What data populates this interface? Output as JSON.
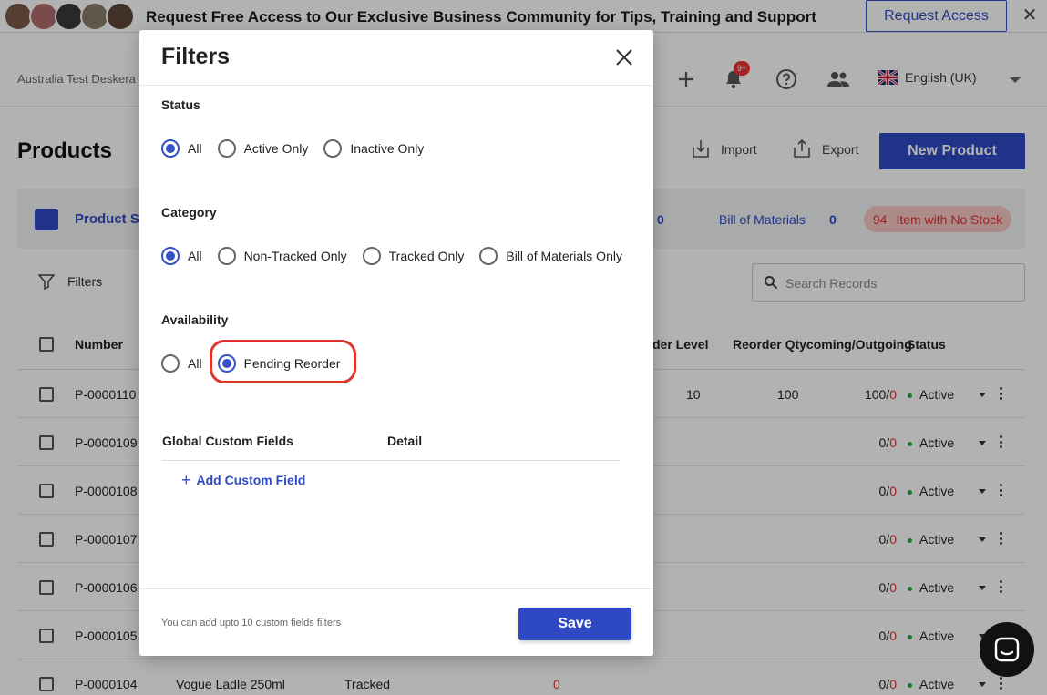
{
  "promo": {
    "text_prefix": "Request ",
    "text_bold": "Free Access",
    "text_suffix": " to Our Exclusive Business Community for Tips, Training and Support",
    "request_label": "Request Access",
    "close_glyph": "✕"
  },
  "header": {
    "company": "Australia Test Deskera",
    "notification_badge": "9+",
    "language": "English (UK)"
  },
  "page": {
    "title": "Products",
    "import_label": "Import",
    "export_label": "Export",
    "new_product_label": "New Product"
  },
  "summary": {
    "title": "Product Su",
    "first_count": "0",
    "bom_label": "Bill of Materials",
    "bom_count": "0",
    "nostock_count": "94",
    "nostock_label": "Item with No Stock"
  },
  "toolbar": {
    "filters_label": "Filters",
    "search_placeholder": "Search Records"
  },
  "table": {
    "headers": {
      "number": "Number",
      "reorder_level": "der Level",
      "reorder_qty_inout": "Reorder Qtycoming/Outgoing",
      "status": "Status"
    },
    "rows": [
      {
        "number": "P-0000110",
        "name": "",
        "type": "",
        "stock": "",
        "reorder_level": "10",
        "reorder_qty": "100",
        "io_main": "100/",
        "io_red": "0",
        "status": "Active"
      },
      {
        "number": "P-0000109",
        "name": "",
        "type": "",
        "stock": "",
        "reorder_level": "",
        "reorder_qty": "",
        "io_main": "0/",
        "io_red": "0",
        "status": "Active"
      },
      {
        "number": "P-0000108",
        "name": "",
        "type": "",
        "stock": "",
        "reorder_level": "",
        "reorder_qty": "",
        "io_main": "0/",
        "io_red": "0",
        "status": "Active"
      },
      {
        "number": "P-0000107",
        "name": "",
        "type": "",
        "stock": "",
        "reorder_level": "",
        "reorder_qty": "",
        "io_main": "0/",
        "io_red": "0",
        "status": "Active"
      },
      {
        "number": "P-0000106",
        "name": "",
        "type": "",
        "stock": "",
        "reorder_level": "",
        "reorder_qty": "",
        "io_main": "0/",
        "io_red": "0",
        "status": "Active"
      },
      {
        "number": "P-0000105",
        "name": "",
        "type": "",
        "stock": "",
        "reorder_level": "",
        "reorder_qty": "",
        "io_main": "0/",
        "io_red": "0",
        "status": "Active"
      },
      {
        "number": "P-0000104",
        "name": "Vogue Ladle 250ml",
        "type": "Tracked",
        "stock": "0",
        "reorder_level": "",
        "reorder_qty": "",
        "io_main": "0/",
        "io_red": "0",
        "status": "Active"
      }
    ]
  },
  "modal": {
    "title": "Filters",
    "status": {
      "label": "Status",
      "options": [
        "All",
        "Active Only",
        "Inactive Only"
      ],
      "selected": "All"
    },
    "category": {
      "label": "Category",
      "options": [
        "All",
        "Non-Tracked Only",
        "Tracked Only",
        "Bill of Materials Only"
      ],
      "selected": "All"
    },
    "availability": {
      "label": "Availability",
      "options": [
        "All",
        "Pending Reorder"
      ],
      "selected": "Pending Reorder"
    },
    "custom_fields": {
      "col_field": "Global Custom Fields",
      "col_detail": "Detail",
      "add_label": "Add Custom Field"
    },
    "footer_note": "You can add upto 10 custom fields filters",
    "save_label": "Save"
  },
  "colors": {
    "accent": "#2f49c4",
    "highlight": "#e0342c",
    "danger": "#d9342b",
    "active_dot": "#2aa84a"
  }
}
